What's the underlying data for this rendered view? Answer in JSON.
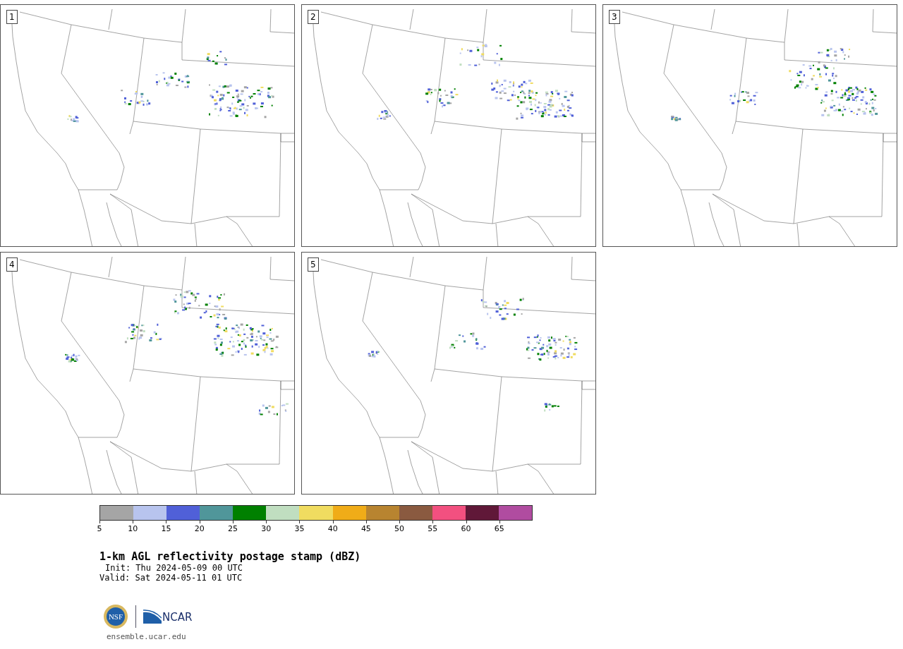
{
  "panels": [
    {
      "label": "1"
    },
    {
      "label": "2"
    },
    {
      "label": "3"
    },
    {
      "label": "4"
    },
    {
      "label": "5"
    }
  ],
  "colorbar": {
    "bins": [
      {
        "color": "#a5a5a5"
      },
      {
        "color": "#b8c4ee"
      },
      {
        "color": "#5060d8"
      },
      {
        "color": "#50969a"
      },
      {
        "color": "#008000"
      },
      {
        "color": "#c0dec0"
      },
      {
        "color": "#f0dc60"
      },
      {
        "color": "#f0ac18"
      },
      {
        "color": "#b88430"
      },
      {
        "color": "#8a5a40"
      },
      {
        "color": "#f25080"
      },
      {
        "color": "#601838"
      },
      {
        "color": "#b04ca0"
      }
    ],
    "ticks": [
      "5",
      "10",
      "15",
      "20",
      "25",
      "30",
      "35",
      "40",
      "45",
      "50",
      "55",
      "60",
      "65"
    ]
  },
  "title": "1-km AGL reflectivity postage stamp (dBZ)",
  "init": "Init: Thu 2024-05-09 00 UTC",
  "valid": "Valid: Sat 2024-05-11 01 UTC",
  "logos": {
    "nsf_text": "NSF",
    "ncar_text": "NCAR"
  },
  "website": "ensemble.ucar.edu"
}
